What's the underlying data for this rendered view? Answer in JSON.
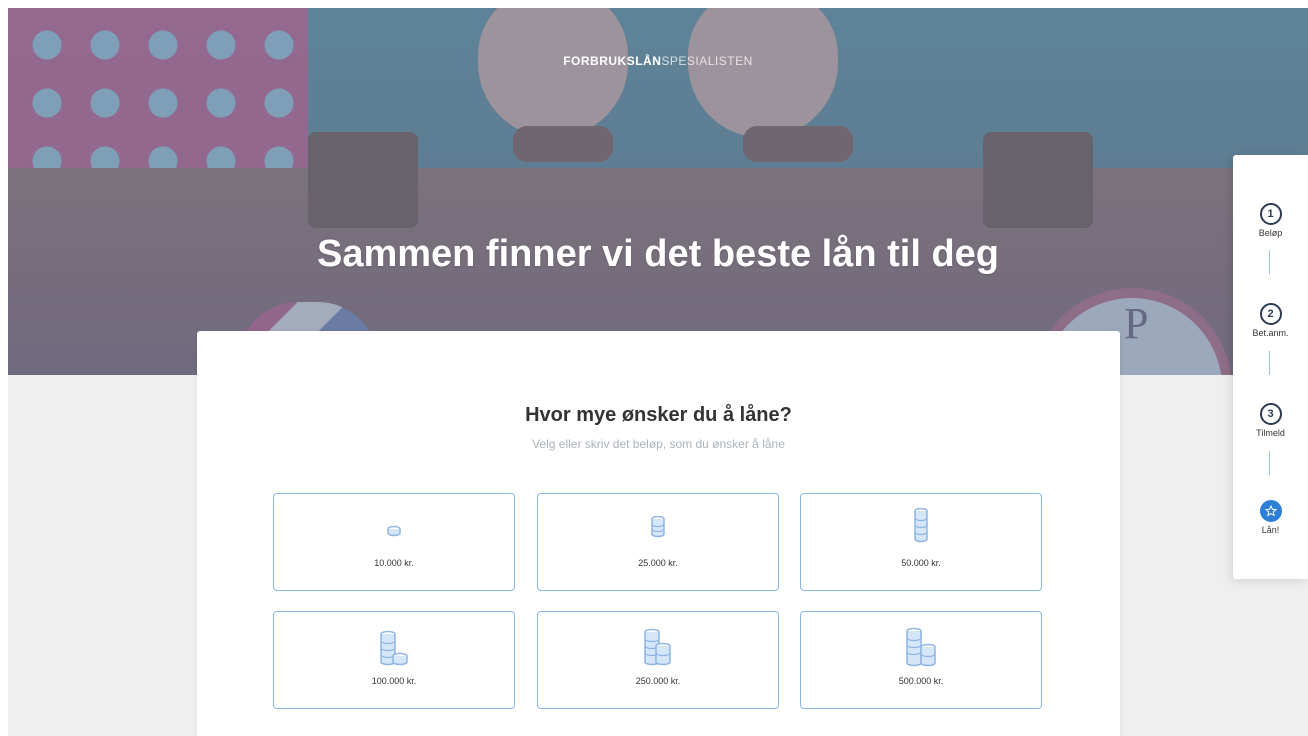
{
  "brand": {
    "logo_bold": "FORBRUKSLÅN",
    "logo_light": "SPESIALISTEN"
  },
  "hero": {
    "title": "Sammen finner vi det beste lån til deg"
  },
  "form": {
    "title": "Hvor mye ønsker du å låne?",
    "subtitle": "Velg eller skriv det beløp, som du ønsker å låne",
    "options": [
      {
        "label": "10.000 kr.",
        "icon": "coin-stack-small-icon"
      },
      {
        "label": "25.000 kr.",
        "icon": "coin-stack-medium-icon"
      },
      {
        "label": "50.000 kr.",
        "icon": "coin-stack-tall-icon"
      },
      {
        "label": "100.000 kr.",
        "icon": "coin-stacks-icon"
      },
      {
        "label": "250.000 kr.",
        "icon": "coin-stacks-icon"
      },
      {
        "label": "500.000 kr.",
        "icon": "coin-stacks-large-icon"
      }
    ]
  },
  "steps": [
    {
      "number": "1",
      "label": "Beløp"
    },
    {
      "number": "2",
      "label": "Bet.anm."
    },
    {
      "number": "3",
      "label": "Tilmeld"
    },
    {
      "number": "",
      "label": "Lån!",
      "icon": "star-icon"
    }
  ],
  "colors": {
    "accent": "#2f7fd6",
    "option_border": "#8bb6e8",
    "coin": "#8fb5e4"
  }
}
